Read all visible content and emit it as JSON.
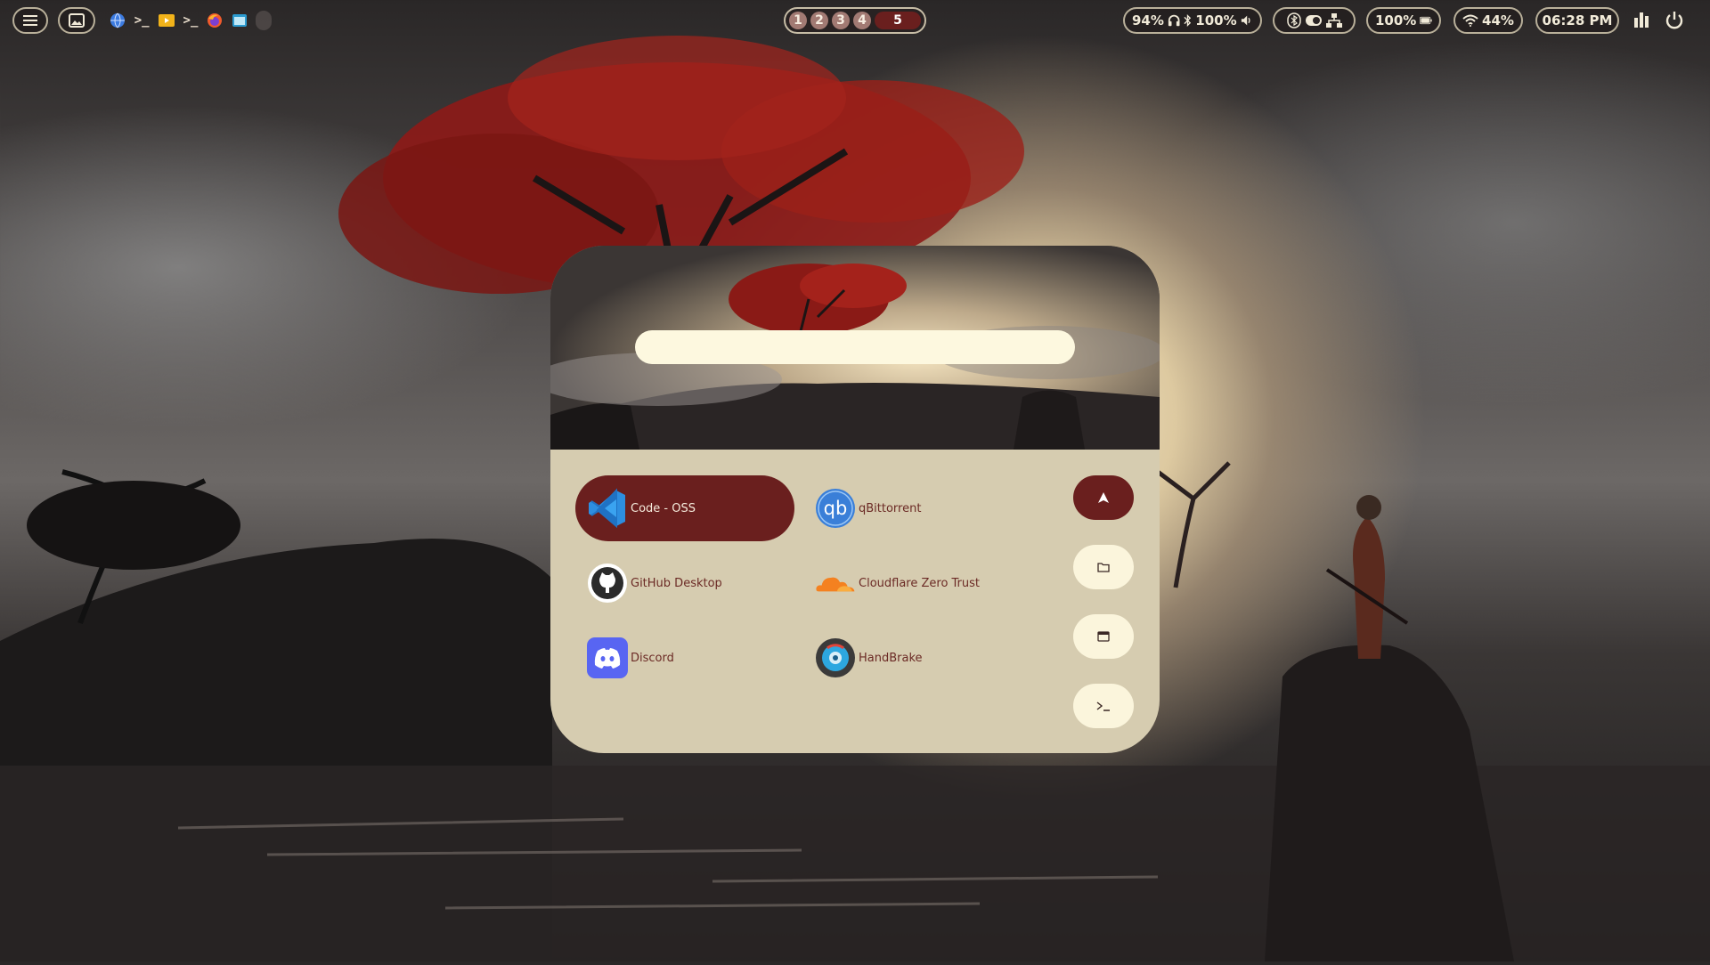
{
  "topbar": {
    "workspaces": [
      "1",
      "2",
      "3",
      "4",
      "5"
    ],
    "active_workspace": "5",
    "headset_battery": "94%",
    "bluetooth_battery": "100%",
    "battery": "100%",
    "wifi": "44%",
    "clock": "06:28 PM",
    "tray_apps": [
      "browser-icon",
      "terminal-icon",
      "files-icon",
      "terminal-icon",
      "firefox-icon",
      "window-icon"
    ]
  },
  "launcher": {
    "search": {
      "value": "",
      "placeholder": ""
    },
    "apps": [
      {
        "label": "Code - OSS",
        "icon": "vscode-icon",
        "selected": true
      },
      {
        "label": "qBittorrent",
        "icon": "qbittorrent-icon",
        "selected": false
      },
      {
        "label": "GitHub Desktop",
        "icon": "github-icon",
        "selected": false
      },
      {
        "label": "Cloudflare Zero Trust",
        "icon": "cloudflare-icon",
        "selected": false
      },
      {
        "label": "Discord",
        "icon": "discord-icon",
        "selected": false
      },
      {
        "label": "HandBrake",
        "icon": "handbrake-icon",
        "selected": false
      }
    ],
    "modes": [
      {
        "icon": "apps-mode-icon",
        "active": true
      },
      {
        "icon": "folder-icon",
        "active": false
      },
      {
        "icon": "window-mode-icon",
        "active": false
      },
      {
        "icon": "terminal-prompt-icon",
        "active": false
      }
    ]
  },
  "colors": {
    "accent": "#6a1f1e",
    "panel": "#d6ccb0",
    "search_field": "#fdf8df",
    "text": "#6b2a25"
  }
}
